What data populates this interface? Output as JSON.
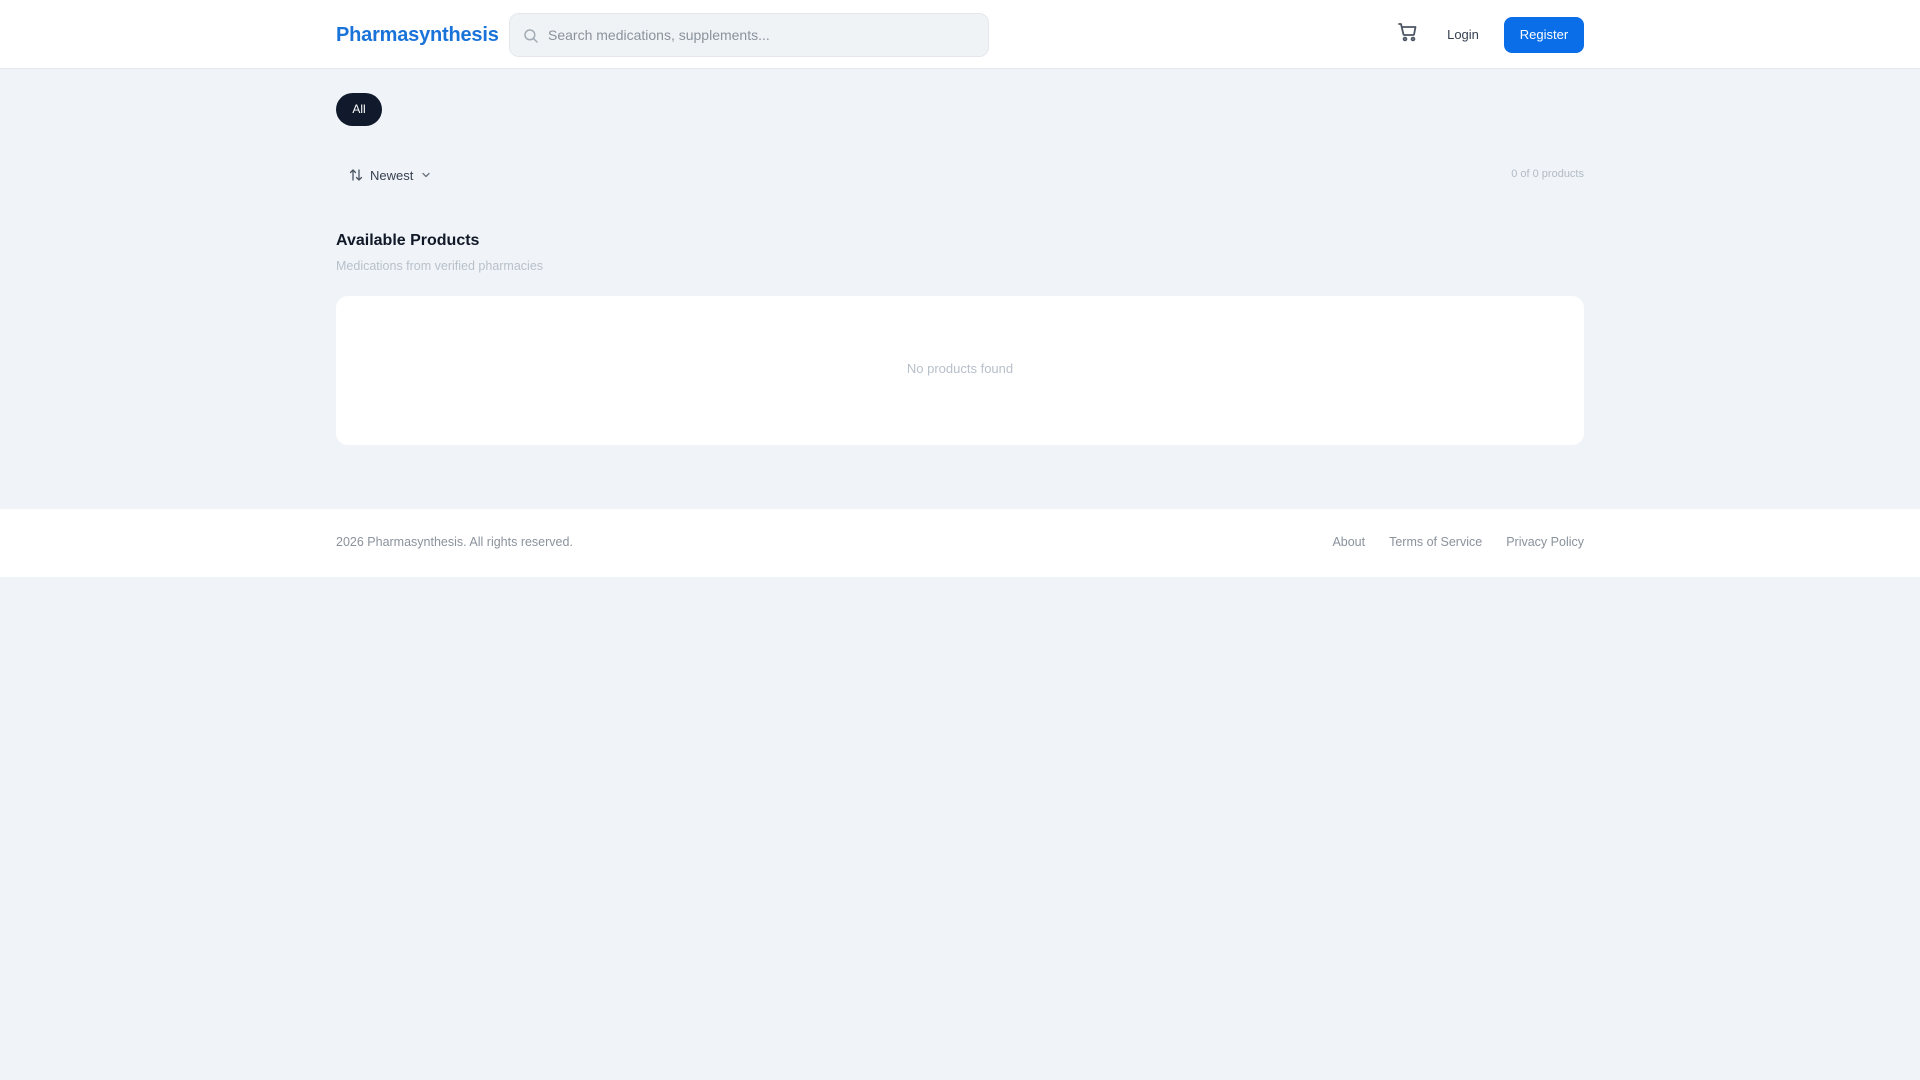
{
  "header": {
    "logo": "Pharmasynthesis",
    "search_placeholder": "Search medications, supplements...",
    "cart_icon": "cart-icon",
    "login_label": "Login",
    "register_label": "Register"
  },
  "filters": {
    "chips": [
      {
        "label": "All",
        "active": true
      }
    ],
    "sort_label": "Newest",
    "count_text": "0 of 0 products"
  },
  "products": {
    "title": "Available Products",
    "subtitle": "Medications from verified pharmacies",
    "empty_text": "No products found"
  },
  "footer": {
    "copyright": "2026 Pharmasynthesis. All rights reserved.",
    "links": [
      "About",
      "Terms of Service",
      "Privacy Policy"
    ]
  },
  "colors": {
    "brand": "#1a73d9",
    "primary_button": "#0a6ee8",
    "active_chip": "#111a2c",
    "page_background": "#f0f4f8"
  }
}
